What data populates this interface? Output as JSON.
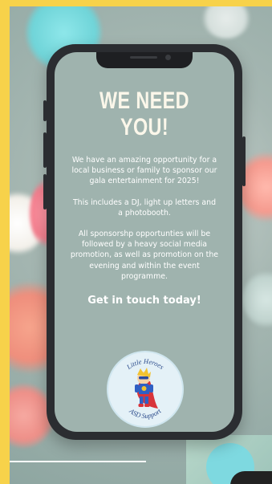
{
  "poster": {
    "headline_line1": "WE NEED",
    "headline_line2": "YOU!",
    "paragraph_1": "We have an amazing opportunity for a local business or family to sponsor our gala entertainment for 2025!",
    "paragraph_2": "This includes a DJ, light up letters and a photobooth.",
    "paragraph_3": "All sponsorshp opportunties will be followed by a heavy social media promotion, as well as promotion on the evening and within the event programme.",
    "call_to_action": "Get in touch today!"
  },
  "logo": {
    "top_text": "Little Heroes",
    "bottom_text": "ASD Support",
    "icon": "superhero-mascot-icon"
  },
  "colors": {
    "frame_yellow": "#f7d24a",
    "screen_bg": "#9fb3ae",
    "phone_body": "#2b2d31",
    "headline_cream": "#fbf7ea"
  }
}
